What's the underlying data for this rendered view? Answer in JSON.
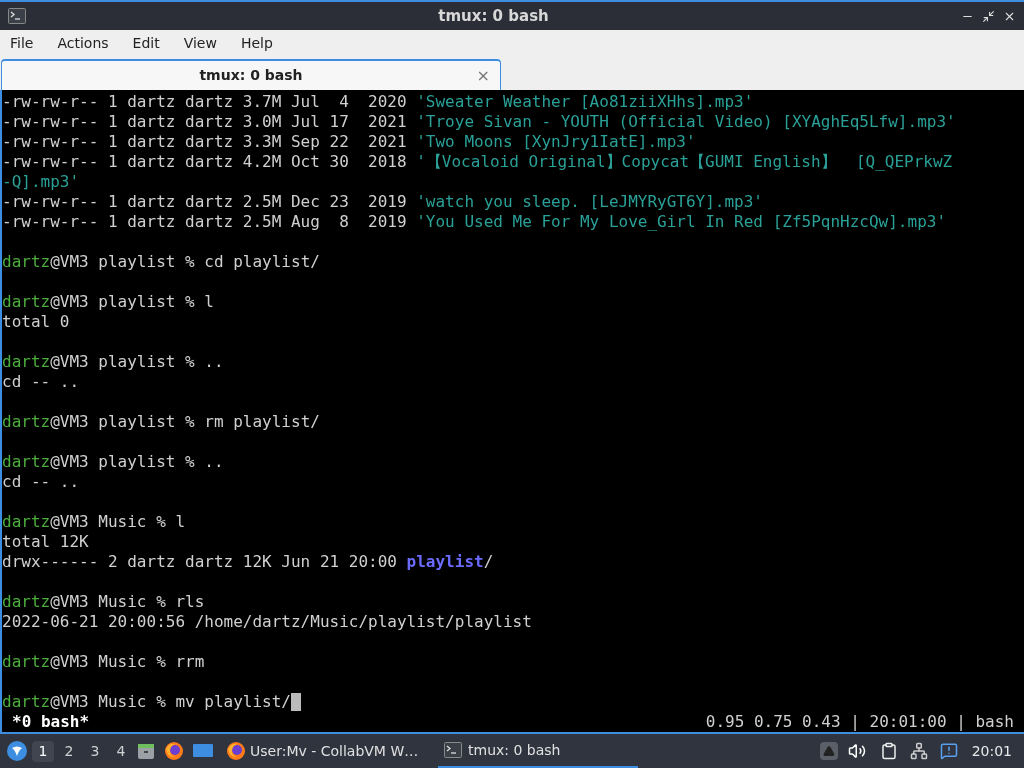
{
  "window": {
    "title": "tmux: 0 bash"
  },
  "menu": [
    "File",
    "Actions",
    "Edit",
    "View",
    "Help"
  ],
  "tabs": [
    {
      "label": "tmux: 0 bash",
      "selected": true,
      "close": "×"
    }
  ],
  "terminal": {
    "lines": [
      {
        "kind": "text",
        "parts": [
          {
            "kind": "plain",
            "text": "-rw-rw-r-- 1 dartz dartz 3.7M Jul  4  2020 "
          },
          {
            "kind": "file",
            "text": "'Sweater Weather [Ao81ziiXHhs].mp3'"
          }
        ]
      },
      {
        "kind": "text",
        "parts": [
          {
            "kind": "plain",
            "text": "-rw-rw-r-- 1 dartz dartz 3.0M Jul 17  2021 "
          },
          {
            "kind": "file",
            "text": "'Troye Sivan - YOUTH (Official Video) [XYAghEq5Lfw].mp3'"
          }
        ]
      },
      {
        "kind": "text",
        "parts": [
          {
            "kind": "plain",
            "text": "-rw-rw-r-- 1 dartz dartz 3.3M Sep 22  2021 "
          },
          {
            "kind": "file",
            "text": "'Two Moons [XynJry1IatE].mp3'"
          }
        ]
      },
      {
        "kind": "text",
        "parts": [
          {
            "kind": "plain",
            "text": "-rw-rw-r-- 1 dartz dartz 4.2M Oct 30  2018 "
          },
          {
            "kind": "file",
            "text": "'【Vocaloid Original】Copycat【GUMI English】  [Q_QEPrkwZ"
          }
        ]
      },
      {
        "kind": "text",
        "parts": [
          {
            "kind": "file",
            "text": "-Q].mp3'"
          }
        ]
      },
      {
        "kind": "text",
        "parts": [
          {
            "kind": "plain",
            "text": "-rw-rw-r-- 1 dartz dartz 2.5M Dec 23  2019 "
          },
          {
            "kind": "file",
            "text": "'watch you sleep. [LeJMYRyGT6Y].mp3'"
          }
        ]
      },
      {
        "kind": "text",
        "parts": [
          {
            "kind": "plain",
            "text": "-rw-rw-r-- 1 dartz dartz 2.5M Aug  8  2019 "
          },
          {
            "kind": "file",
            "text": "'You Used Me For My Love_Girl In Red [Zf5PqnHzcQw].mp3'"
          }
        ]
      },
      {
        "kind": "blank"
      },
      {
        "kind": "text",
        "parts": [
          {
            "kind": "user",
            "text": "dartz"
          },
          {
            "kind": "plain",
            "text": "@VM3 playlist % cd playlist/"
          }
        ]
      },
      {
        "kind": "blank"
      },
      {
        "kind": "text",
        "parts": [
          {
            "kind": "user",
            "text": "dartz"
          },
          {
            "kind": "plain",
            "text": "@VM3 playlist % l"
          }
        ]
      },
      {
        "kind": "text",
        "parts": [
          {
            "kind": "plain",
            "text": "total 0"
          }
        ]
      },
      {
        "kind": "blank"
      },
      {
        "kind": "text",
        "parts": [
          {
            "kind": "user",
            "text": "dartz"
          },
          {
            "kind": "plain",
            "text": "@VM3 playlist % .."
          }
        ]
      },
      {
        "kind": "text",
        "parts": [
          {
            "kind": "plain",
            "text": "cd -- .."
          }
        ]
      },
      {
        "kind": "blank"
      },
      {
        "kind": "text",
        "parts": [
          {
            "kind": "user",
            "text": "dartz"
          },
          {
            "kind": "plain",
            "text": "@VM3 playlist % rm playlist/"
          }
        ]
      },
      {
        "kind": "blank"
      },
      {
        "kind": "text",
        "parts": [
          {
            "kind": "user",
            "text": "dartz"
          },
          {
            "kind": "plain",
            "text": "@VM3 playlist % .."
          }
        ]
      },
      {
        "kind": "text",
        "parts": [
          {
            "kind": "plain",
            "text": "cd -- .."
          }
        ]
      },
      {
        "kind": "blank"
      },
      {
        "kind": "text",
        "parts": [
          {
            "kind": "user",
            "text": "dartz"
          },
          {
            "kind": "plain",
            "text": "@VM3 Music % l"
          }
        ]
      },
      {
        "kind": "text",
        "parts": [
          {
            "kind": "plain",
            "text": "total 12K"
          }
        ]
      },
      {
        "kind": "text",
        "parts": [
          {
            "kind": "plain",
            "text": "drwx------ 2 dartz dartz 12K Jun 21 20:00 "
          },
          {
            "kind": "dir",
            "text": "playlist"
          },
          {
            "kind": "plain",
            "text": "/"
          }
        ]
      },
      {
        "kind": "blank"
      },
      {
        "kind": "text",
        "parts": [
          {
            "kind": "user",
            "text": "dartz"
          },
          {
            "kind": "plain",
            "text": "@VM3 Music % rls"
          }
        ]
      },
      {
        "kind": "text",
        "parts": [
          {
            "kind": "plain",
            "text": "2022-06-21 20:00:56 /home/dartz/Music/playlist/playlist"
          }
        ]
      },
      {
        "kind": "blank"
      },
      {
        "kind": "text",
        "parts": [
          {
            "kind": "user",
            "text": "dartz"
          },
          {
            "kind": "plain",
            "text": "@VM3 Music % rrm"
          }
        ]
      },
      {
        "kind": "blank"
      },
      {
        "kind": "text",
        "cursor": true,
        "parts": [
          {
            "kind": "user",
            "text": "dartz"
          },
          {
            "kind": "plain",
            "text": "@VM3 Music % mv playlist/"
          }
        ]
      }
    ],
    "status_left": "*0 bash*",
    "status_right": "0.95 0.75 0.43 | 20:01:00 | bash"
  },
  "taskbar": {
    "workspaces": [
      {
        "label": "1",
        "selected": true
      },
      {
        "label": "2",
        "selected": false
      },
      {
        "label": "3",
        "selected": false
      },
      {
        "label": "4",
        "selected": false
      }
    ],
    "tasks": [
      {
        "label": "User:Mv - CollabVM W…",
        "kind": "browser",
        "selected": false
      },
      {
        "label": "tmux: 0 bash",
        "kind": "terminal",
        "selected": true
      }
    ],
    "clock": "20:01"
  }
}
